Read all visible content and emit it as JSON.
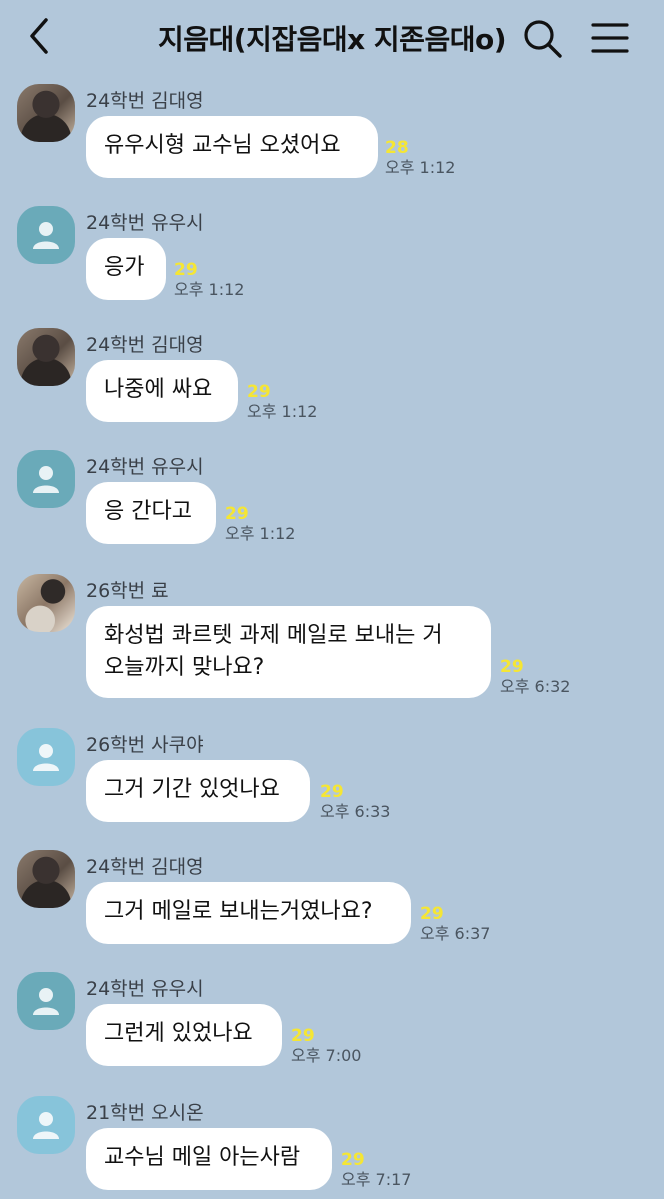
{
  "header": {
    "title": "지음대(지잡음대x 지존음대o)",
    "back_icon": "chevron-left-icon",
    "search_icon": "search-icon",
    "menu_icon": "hamburger-menu-icon"
  },
  "messages": [
    {
      "sender": "24학번 김대영",
      "text": [
        "유우시형 교수님 오셨어요"
      ],
      "unread": "28",
      "time": "오후 1:12",
      "avatar": "photo"
    },
    {
      "sender": "24학번 유우시",
      "text": [
        "응가"
      ],
      "unread": "29",
      "time": "오후 1:12",
      "avatar": "default"
    },
    {
      "sender": "24학번 김대영",
      "text": [
        "나중에 싸요"
      ],
      "unread": "29",
      "time": "오후 1:12",
      "avatar": "photo"
    },
    {
      "sender": "24학번 유우시",
      "text": [
        "응 간다고"
      ],
      "unread": "29",
      "time": "오후 1:12",
      "avatar": "default"
    },
    {
      "sender": "26학번 료",
      "text": [
        "화성법 콰르텟 과제 메일로 보내는 거",
        "오늘까지 맞나요?"
      ],
      "unread": "29",
      "time": "오후 6:32",
      "avatar": "photo2"
    },
    {
      "sender": "26학번 사쿠야",
      "text": [
        "그거 기간 있엇나요"
      ],
      "unread": "29",
      "time": "오후 6:33",
      "avatar": "default-light"
    },
    {
      "sender": "24학번 김대영",
      "text": [
        "그거 메일로 보내는거였나요?"
      ],
      "unread": "29",
      "time": "오후 6:37",
      "avatar": "photo"
    },
    {
      "sender": "24학번 유우시",
      "text": [
        "그런게 있었나요"
      ],
      "unread": "29",
      "time": "오후 7:00",
      "avatar": "default"
    },
    {
      "sender": "21학번 오시온",
      "text": [
        "교수님 메일 아는사람"
      ],
      "unread": "29",
      "time": "오후 7:17",
      "avatar": "default-light"
    }
  ],
  "colors": {
    "background": "#b2c7da",
    "bubble": "#ffffff",
    "unread": "#f5e634",
    "default_avatar": "#6aaab9"
  }
}
